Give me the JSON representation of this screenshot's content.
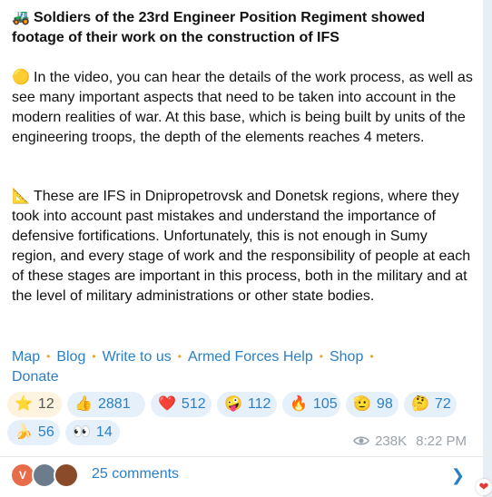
{
  "post": {
    "title_emoji": "🚜",
    "title": "Soldiers of the 23rd Engineer Position Regiment showed footage of their work on the construction of IFS",
    "para1_emoji": "🟡",
    "para1": "In the video, you can hear the details of the work process, as well as see many important aspects that need to be taken into account in the modern realities of war. At this base, which is being built by units of the engineering troops, the depth of the elements reaches 4 meters.",
    "para2_emoji": "📐",
    "para2": "These are IFS in Dnipropetrovsk and Donetsk regions, where they took into account past mistakes and understand the importance of defensive fortifications. Unfortunately, this is not enough in Sumy region, and every stage of work and the responsibility of people at each of these stages are important in this process, both in the military and at the level of military administrations or other state bodies."
  },
  "links": {
    "map": "Map",
    "blog": "Blog",
    "write": "Write to us",
    "help": "Armed Forces Help",
    "shop": "Shop",
    "donate": "Donate",
    "separator": "•",
    "accent_color": "#2a80c7",
    "separator_color": "#e8a432"
  },
  "reactions": {
    "row1": [
      {
        "emoji": "⭐",
        "count": "12"
      },
      {
        "emoji": "👍",
        "count": "2881"
      },
      {
        "emoji": "❤️",
        "count": "512"
      },
      {
        "emoji": "🤪",
        "count": "112"
      },
      {
        "emoji": "🔥",
        "count": "105"
      },
      {
        "emoji": "🫡",
        "count": "98"
      },
      {
        "emoji": "🤔",
        "count": "72"
      }
    ],
    "row2": [
      {
        "emoji": "🍌",
        "count": "56"
      },
      {
        "emoji": "👀",
        "count": "14"
      }
    ]
  },
  "meta": {
    "views": "238K",
    "time": "8:22 PM"
  },
  "comments": {
    "label": "25 comments",
    "avatar1_letter": "V",
    "chevron": "❯"
  },
  "badge": {
    "emoji": "❤"
  }
}
